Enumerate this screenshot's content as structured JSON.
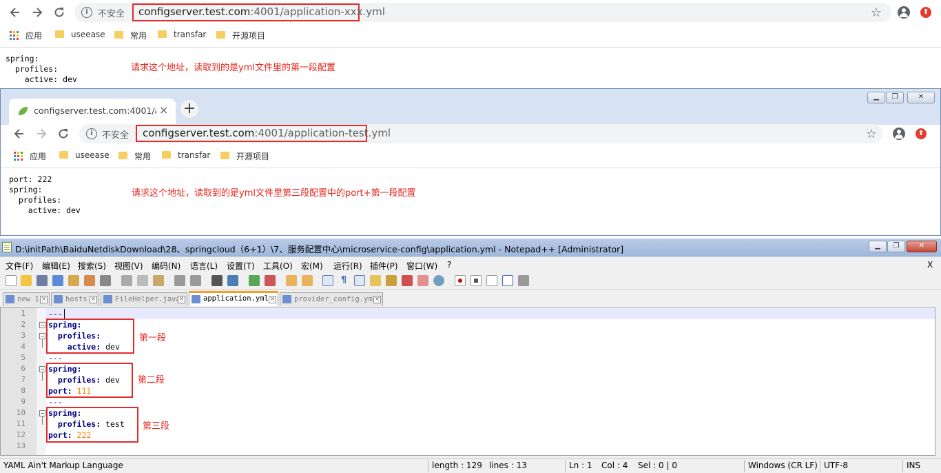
{
  "browser1": {
    "security": "不安全",
    "url_host": "configserver.test.com",
    "url_path": ":4001/application-xxx.yml",
    "bookmarks": [
      "应用",
      "useease",
      "常用",
      "transfar",
      "开源项目"
    ],
    "output": "spring:\n  profiles:\n    active: dev",
    "note": "请求这个地址，读取到的是yml文件里的第一段配置"
  },
  "browser2": {
    "tab_title": "configserver.test.com:4001/ap",
    "tab_close": "×",
    "new_tab": "+",
    "security": "不安全",
    "url_host": "configserver.test.com",
    "url_path": ":4001/application-test.yml",
    "bookmarks": [
      "应用",
      "useease",
      "常用",
      "transfar",
      "开源项目"
    ],
    "output": "port: 222\nspring:\n  profiles:\n    active: dev",
    "note": "请求这个地址，读取到的是yml文件里第三段配置中的port+第一段配置"
  },
  "notepad": {
    "title": "D:\\initPath\\BaiduNetdiskDownload\\28、springcloud（6+1）\\7、服务配置中心\\microservice-config\\application.yml - Notepad++ [Administrator]",
    "menu": [
      "文件(F)",
      "编辑(E)",
      "搜索(S)",
      "视图(V)",
      "编码(N)",
      "语言(L)",
      "设置(T)",
      "工具(O)",
      "宏(M)",
      "运行(R)",
      "插件(P)",
      "窗口(W)",
      "?"
    ],
    "menu_close": "X",
    "tabs": [
      "new 1",
      "hosts",
      "FileHelper.java",
      "application.yml",
      "provider_config.yml"
    ],
    "line_numbers": [
      "1",
      "2",
      "3",
      "4",
      "5",
      "6",
      "7",
      "8",
      "9",
      "10",
      "11",
      "12",
      "13"
    ],
    "code": {
      "l1": "---",
      "l2": "spring:",
      "l3k": "  profiles:",
      "l4k": "    active:",
      "l4v": " dev",
      "l5": "---",
      "l6": "spring:",
      "l7k": "  profiles:",
      "l7v": " dev",
      "l8k": "port:",
      "l8v": " 111",
      "l9": "---",
      "l10": "spring:",
      "l11k": "  profiles:",
      "l11v": " test",
      "l12k": "port:",
      "l12v": " 222"
    },
    "annotations": [
      "第一段",
      "第二段",
      "第三段"
    ],
    "status": {
      "lang": "YAML Ain't Markup Language",
      "length": "length : 129",
      "lines": "lines : 13",
      "ln": "Ln : 1",
      "col": "Col : 4",
      "sel": "Sel : 0 | 0",
      "eol": "Windows (CR LF)",
      "enc": "UTF-8",
      "ins": "INS"
    }
  },
  "colors": {
    "annotation_red": "#e8241d",
    "yaml_key": "#000080",
    "yaml_number": "#ff8000"
  }
}
